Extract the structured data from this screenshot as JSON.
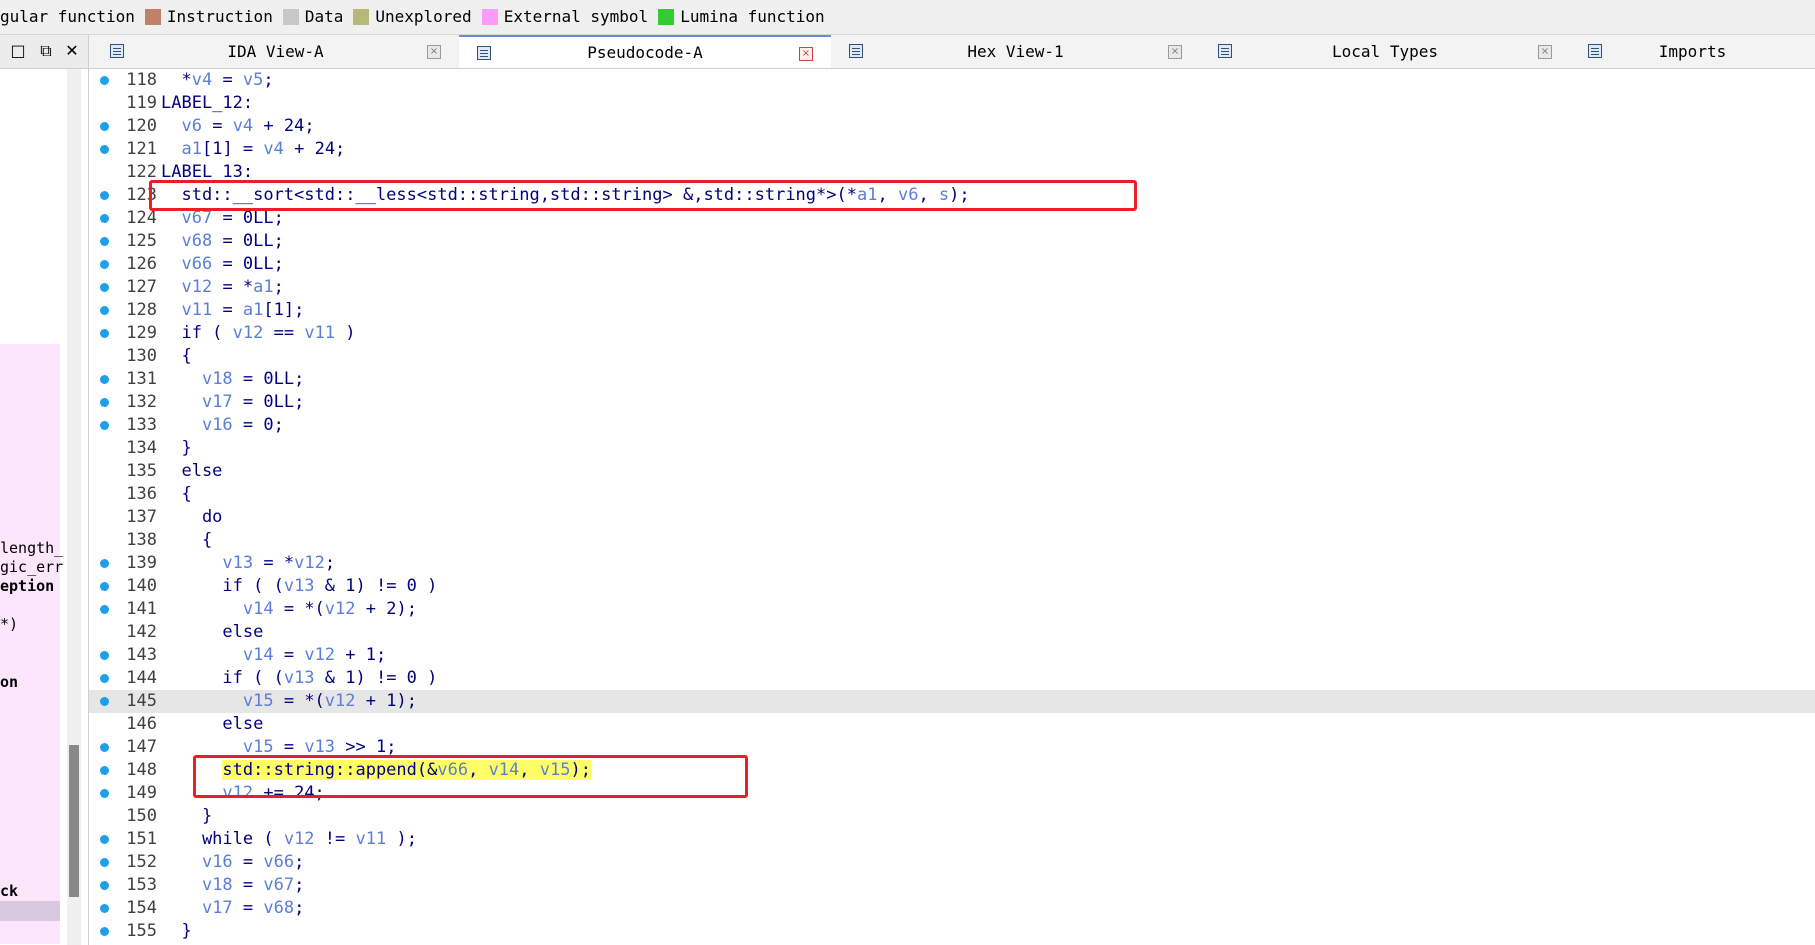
{
  "legend": [
    {
      "label": "gular function",
      "color": ""
    },
    {
      "label": "Instruction",
      "color": "#c0806a"
    },
    {
      "label": "Data",
      "color": "#c8c8c8"
    },
    {
      "label": "Unexplored",
      "color": "#b8b878"
    },
    {
      "label": "External symbol",
      "color": "#ff9cf8"
    },
    {
      "label": "Lumina function",
      "color": "#33cc33"
    }
  ],
  "tabs": [
    {
      "label": "IDA View-A",
      "active": false
    },
    {
      "label": "Pseudocode-A",
      "active": true
    },
    {
      "label": "Hex View-1",
      "active": false
    },
    {
      "label": "Local Types",
      "active": false
    },
    {
      "label": "Imports",
      "active": false
    }
  ],
  "window_controls": {
    "restore": "□",
    "float": "⧉",
    "close": "✕"
  },
  "left_panel": {
    "items": [
      "length_",
      "gic_err",
      "eption",
      " *)",
      "on",
      "ck"
    ]
  },
  "code_lines": [
    {
      "n": "118",
      "dot": true,
      "html": "  *<span class='v'>v4</span> = <span class='v'>v5</span>;"
    },
    {
      "n": "119",
      "dot": false,
      "html": "LABEL_12:"
    },
    {
      "n": "120",
      "dot": true,
      "html": "  <span class='v'>v6</span> = <span class='v'>v4</span> + 24;"
    },
    {
      "n": "121",
      "dot": true,
      "html": "  <span class='v'>a1</span>[1] = <span class='v'>v4</span> + 24;"
    },
    {
      "n": "122",
      "dot": false,
      "html": "LABEL_13:"
    },
    {
      "n": "123",
      "dot": true,
      "html": "  std::__sort&lt;std::__less&lt;std::string,std::string&gt; &amp;,std::string*&gt;(*<span class='v'>a1</span>, <span class='v'>v6</span>, <span class='v'>s</span>);"
    },
    {
      "n": "124",
      "dot": true,
      "html": "  <span class='v'>v67</span> = 0LL;"
    },
    {
      "n": "125",
      "dot": true,
      "html": "  <span class='v'>v68</span> = 0LL;"
    },
    {
      "n": "126",
      "dot": true,
      "html": "  <span class='v'>v66</span> = 0LL;"
    },
    {
      "n": "127",
      "dot": true,
      "html": "  <span class='v'>v12</span> = *<span class='v'>a1</span>;"
    },
    {
      "n": "128",
      "dot": true,
      "html": "  <span class='v'>v11</span> = <span class='v'>a1</span>[1];"
    },
    {
      "n": "129",
      "dot": true,
      "html": "  if ( <span class='v'>v12</span> == <span class='v'>v11</span> )"
    },
    {
      "n": "130",
      "dot": false,
      "html": "  {"
    },
    {
      "n": "131",
      "dot": true,
      "html": "    <span class='v'>v18</span> = 0LL;"
    },
    {
      "n": "132",
      "dot": true,
      "html": "    <span class='v'>v17</span> = 0LL;"
    },
    {
      "n": "133",
      "dot": true,
      "html": "    <span class='v'>v16</span> = 0;"
    },
    {
      "n": "134",
      "dot": false,
      "html": "  }"
    },
    {
      "n": "135",
      "dot": false,
      "html": "  else"
    },
    {
      "n": "136",
      "dot": false,
      "html": "  {"
    },
    {
      "n": "137",
      "dot": false,
      "html": "    do"
    },
    {
      "n": "138",
      "dot": false,
      "html": "    {"
    },
    {
      "n": "139",
      "dot": true,
      "html": "      <span class='v'>v13</span> = *<span class='v'>v12</span>;"
    },
    {
      "n": "140",
      "dot": true,
      "html": "      if ( (<span class='v'>v13</span> &amp; 1) != 0 )"
    },
    {
      "n": "141",
      "dot": true,
      "html": "        <span class='v'>v14</span> = *(<span class='v'>v12</span> + 2);"
    },
    {
      "n": "142",
      "dot": false,
      "html": "      else"
    },
    {
      "n": "143",
      "dot": true,
      "html": "        <span class='v'>v14</span> = <span class='v'>v12</span> + 1;"
    },
    {
      "n": "144",
      "dot": true,
      "html": "      if ( (<span class='v'>v13</span> &amp; 1) != 0 )"
    },
    {
      "n": "145",
      "dot": true,
      "html": "        <span class='v'>v15</span> = *(<span class='v'>v12</span> + 1);",
      "current": true
    },
    {
      "n": "146",
      "dot": false,
      "html": "      else"
    },
    {
      "n": "147",
      "dot": true,
      "html": "        <span class='v'>v15</span> = <span class='v'>v13</span> &gt;&gt; 1;"
    },
    {
      "n": "148",
      "dot": true,
      "html": "      <span class='hl'>std::string::append(&amp;<span class='v'>v66</span>, <span class='v'>v14</span>, <span class='v'>v15</span>);</span>"
    },
    {
      "n": "149",
      "dot": true,
      "html": "      <span class='v'>v12</span> += 24;"
    },
    {
      "n": "150",
      "dot": false,
      "html": "    }"
    },
    {
      "n": "151",
      "dot": true,
      "html": "    while ( <span class='v'>v12</span> != <span class='v'>v11</span> );"
    },
    {
      "n": "152",
      "dot": true,
      "html": "    <span class='v'>v16</span> = <span class='v'>v66</span>;"
    },
    {
      "n": "153",
      "dot": true,
      "html": "    <span class='v'>v18</span> = <span class='v'>v67</span>;"
    },
    {
      "n": "154",
      "dot": true,
      "html": "    <span class='v'>v17</span> = <span class='v'>v68</span>;"
    },
    {
      "n": "155",
      "dot": true,
      "html": "  }"
    }
  ],
  "annotations": [
    {
      "label": "sort-call-annotation",
      "line": "123"
    },
    {
      "label": "append-call-annotation",
      "line": "148"
    }
  ]
}
